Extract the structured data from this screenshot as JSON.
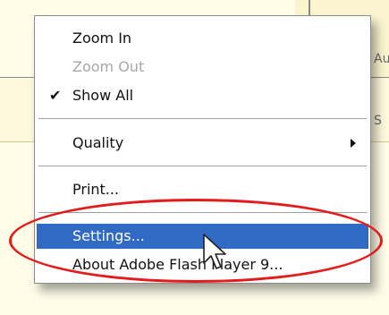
{
  "backdrop": {
    "partial_text_right": "Au",
    "partial_text_right2": "S"
  },
  "context_menu": {
    "items": [
      {
        "label": "Zoom In",
        "state": "enabled"
      },
      {
        "label": "Zoom Out",
        "state": "disabled"
      },
      {
        "label": "Show All",
        "state": "checked"
      },
      {
        "label": "Quality",
        "state": "submenu"
      },
      {
        "label": "Print...",
        "state": "enabled"
      },
      {
        "label": "Settings...",
        "state": "highlighted"
      },
      {
        "label": "About Adobe Flash Player 9...",
        "state": "enabled"
      }
    ],
    "check_glyph": "✔"
  },
  "colors": {
    "highlight": "#316ac5",
    "annotation": "#e41b1b",
    "disabled_text": "#a7a7a7"
  },
  "annotation": {
    "shape": "ellipse",
    "target": "Settings... / About Adobe Flash Player 9..."
  }
}
